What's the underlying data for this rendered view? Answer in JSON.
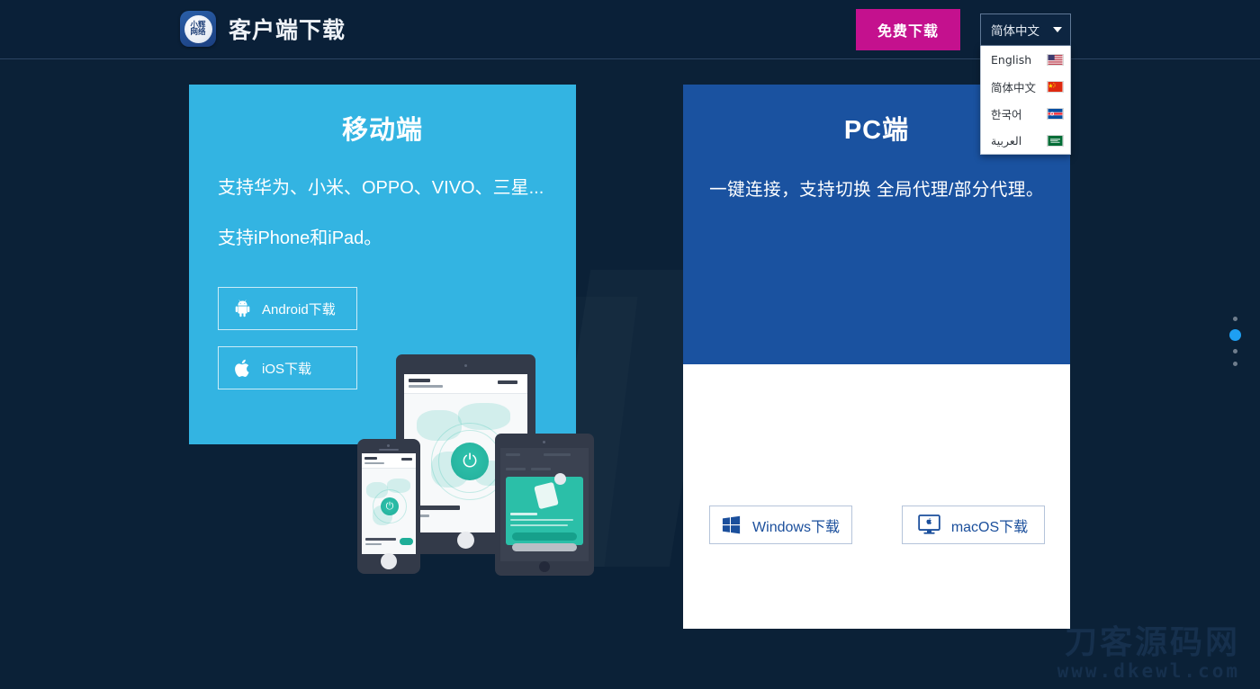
{
  "header": {
    "logo_text_top": "小辉",
    "logo_text_bottom": "网络",
    "title": "客户端下载",
    "free_download_label": "免费下载",
    "language": {
      "selected": "简体中文",
      "options": [
        {
          "label": "English",
          "flag": "us-flag-icon"
        },
        {
          "label": "简体中文",
          "flag": "cn-flag-icon"
        },
        {
          "label": "한국어",
          "flag": "kr-flag-icon"
        },
        {
          "label": "العربية",
          "flag": "sa-flag-icon"
        }
      ]
    }
  },
  "mobile_card": {
    "title": "移动端",
    "line1": "支持华为、小米、OPPO、VIVO、三星...",
    "line2": "支持iPhone和iPad。",
    "buttons": [
      {
        "label": "Android下载",
        "icon": "android-icon"
      },
      {
        "label": "iOS下载",
        "icon": "apple-icon"
      }
    ]
  },
  "pc_card": {
    "title": "PC端",
    "subtitle": "一键连接，支持切换 全局代理/部分代理。",
    "buttons": [
      {
        "label": "Windows下载",
        "icon": "windows-icon"
      },
      {
        "label": "macOS下载",
        "icon": "imac-apple-icon"
      }
    ]
  },
  "pager": {
    "dots": 4,
    "active_index": 1
  },
  "watermark": {
    "cn": "刀客源码网",
    "en": "www.dkewl.com"
  },
  "colors": {
    "page_bg": "#0b2137",
    "header_bg": "#0a2038",
    "accent_magenta": "#c4118e",
    "mobile_card": "#33b4e2",
    "pc_card": "#1a52a0",
    "pager_active": "#1e9ff2",
    "app_teal": "#2dbda4"
  }
}
